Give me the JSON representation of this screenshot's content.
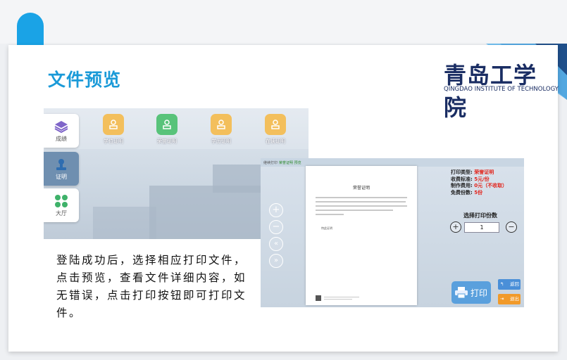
{
  "slide": {
    "title": "文件预览",
    "logo_cn": "青岛工学院",
    "logo_en": "QINGDAO INSTITUTE OF TECHNOLOGY",
    "paragraph": "登陆成功后，选择相应打印文件，点击预览，查看文件详细内容，如无错误，点击打印按钮即可打印文件。",
    "accent_color": "#1aa3e6",
    "title_color": "#1a9ad8"
  },
  "screen1": {
    "side_tabs": [
      {
        "label": "成绩",
        "icon": "layers-icon"
      },
      {
        "label": "证明",
        "icon": "stamp-icon"
      },
      {
        "label": "大厅",
        "icon": "grid-icon"
      }
    ],
    "cert_items": [
      {
        "label": "学位证明",
        "icon": "stamp-icon"
      },
      {
        "label": "荣誉证明",
        "icon": "stamp-icon"
      },
      {
        "label": "学历证明",
        "icon": "stamp-icon"
      },
      {
        "label": "在读证明",
        "icon": "stamp-icon"
      }
    ]
  },
  "screen2": {
    "header_left": "继续打印",
    "header_mid": "荣誉证明 预览",
    "doc_title": "荣誉证明",
    "doc_sign": "特此证明",
    "info": [
      {
        "label": "打印类型:",
        "value": "荣誉证明"
      },
      {
        "label": "收费标准:",
        "value": "5元/份"
      },
      {
        "label": "制作费用:",
        "value": "0元（不收取）"
      },
      {
        "label": "免费份数:",
        "value": "5份"
      }
    ],
    "select_label": "选择打印份数",
    "quantity": "1",
    "print_label": "打印",
    "back_label": "返回",
    "exit_label": "退出"
  }
}
